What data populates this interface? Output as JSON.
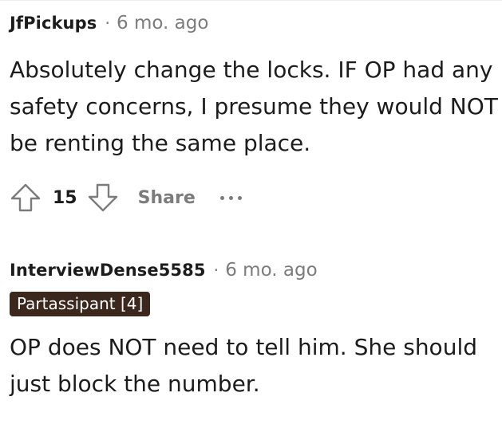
{
  "comments": [
    {
      "author": "JfPickups",
      "separator": "·",
      "time": "6 mo. ago",
      "body": "Absolutely change the locks. IF OP had any safety concerns, I presume they would NOT be renting the same place.",
      "score": "15",
      "share_label": "Share",
      "icons": {
        "upvote": "upvote-arrow-icon",
        "downvote": "downvote-arrow-icon",
        "more": "more-options-icon"
      }
    },
    {
      "author": "InterviewDense5585",
      "separator": "·",
      "time": "6 mo. ago",
      "flair": "Partassipant [4]",
      "flair_color": "#3b271c",
      "body": "OP does NOT need to tell him. She should just block the number."
    }
  ]
}
